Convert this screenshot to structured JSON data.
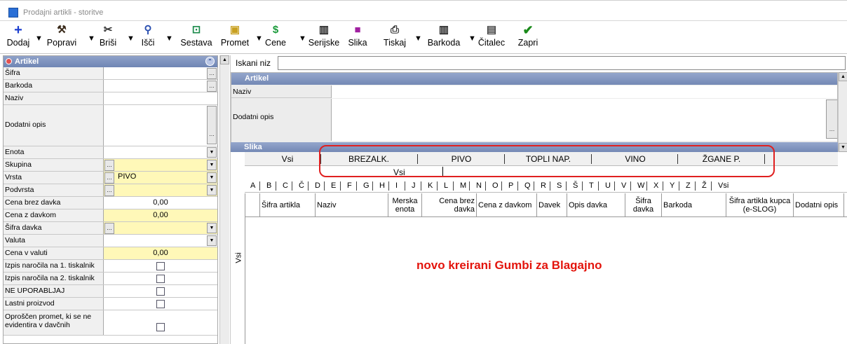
{
  "window": {
    "title": "Prodajni artikli - storitve"
  },
  "toolbar": [
    {
      "key": "dodaj",
      "label": "Dodaj",
      "icon": "plus-icon"
    },
    {
      "key": "popravi",
      "label": "Popravi",
      "icon": "hammer-icon"
    },
    {
      "key": "brisi",
      "label": "Briši",
      "icon": "scissors-icon"
    },
    {
      "key": "isci",
      "label": "Išči",
      "icon": "magnifier-icon"
    },
    {
      "key": "sestava",
      "label": "Sestava",
      "icon": "composition-icon"
    },
    {
      "key": "promet",
      "label": "Promet",
      "icon": "traffic-icon"
    },
    {
      "key": "cene",
      "label": "Cene",
      "icon": "dollar-icon"
    },
    {
      "key": "serijske",
      "label": "Serijske",
      "icon": "serial-icon"
    },
    {
      "key": "slika",
      "label": "Slika",
      "icon": "image-icon"
    },
    {
      "key": "tiskaj",
      "label": "Tiskaj",
      "icon": "printer-icon"
    },
    {
      "key": "barkoda",
      "label": "Barkoda",
      "icon": "barcode-icon"
    },
    {
      "key": "citalec",
      "label": "Čitalec",
      "icon": "reader-icon"
    },
    {
      "key": "zapri",
      "label": "Zapri",
      "icon": "checkmark-icon"
    }
  ],
  "left": {
    "title": "Artikel",
    "fields": [
      {
        "label": "Šifra",
        "value": ""
      },
      {
        "label": "Barkoda",
        "value": ""
      },
      {
        "label": "Naziv",
        "value": ""
      },
      {
        "label": "Dodatni opis",
        "value": ""
      },
      {
        "label": "Enota",
        "value": ""
      },
      {
        "label": "Skupina",
        "value": ""
      },
      {
        "label": "Vrsta",
        "value": "PIVO"
      },
      {
        "label": "Podvrsta",
        "value": ""
      },
      {
        "label": "Cena brez davka",
        "value": "0,00"
      },
      {
        "label": "Cena z davkom",
        "value": "0,00"
      },
      {
        "label": "Šifra davka",
        "value": ""
      },
      {
        "label": "Valuta",
        "value": ""
      },
      {
        "label": "Cena v valuti",
        "value": "0,00"
      },
      {
        "label": "Izpis naročila na 1. tiskalnik",
        "value": ""
      },
      {
        "label": "Izpis naročila na 2. tiskalnik",
        "value": ""
      },
      {
        "label": "NE UPORABLJAJ",
        "value": ""
      },
      {
        "label": "Lastni proizvod",
        "value": ""
      },
      {
        "label": "Oproščen promet, ki se ne evidentira v davčnih",
        "value": ""
      }
    ]
  },
  "right": {
    "search_label": "Iskani niz",
    "search_value": "",
    "section_artikel": "Artikel",
    "naziv_label": "Naziv",
    "dodatni_label": "Dodatni opis",
    "section_slika": "Slika",
    "group_tabs": [
      "Vsi",
      "BREZALK.",
      "PIVO",
      "TOPLI NAP.",
      "VINO",
      "ŽGANE P."
    ],
    "subtab": "Vsi",
    "alphabet": [
      "A",
      "B",
      "C",
      "Č",
      "D",
      "E",
      "F",
      "G",
      "H",
      "I",
      "J",
      "K",
      "L",
      "M",
      "N",
      "O",
      "P",
      "Q",
      "R",
      "S",
      "Š",
      "T",
      "U",
      "V",
      "W",
      "X",
      "Y",
      "Z",
      "Ž",
      "Vsi"
    ],
    "columns": [
      "Šifra artikla",
      "Naziv",
      "Merska enota",
      "Cena brez davka",
      "Cena z davkom",
      "Davek",
      "Opis davka",
      "Šifra davka",
      "Barkoda",
      "Šifra artikla kupca (e-SLOG)",
      "Dodatni opis"
    ],
    "vertical_tab": "Vsi",
    "note": "novo kreirani Gumbi za Blagajno"
  },
  "colors": {
    "accent_header": "#7489b5",
    "highlight_yellow": "#fff8b8",
    "annotation_red": "#e3140c"
  }
}
